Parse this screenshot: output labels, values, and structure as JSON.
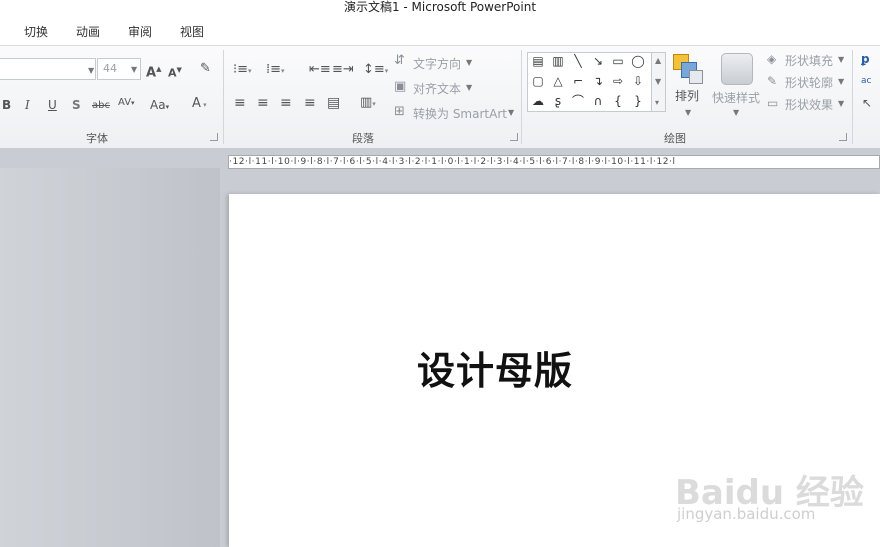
{
  "window": {
    "title": "演示文稿1 - Microsoft PowerPoint"
  },
  "tabs": [
    {
      "label": "切换"
    },
    {
      "label": "动画"
    },
    {
      "label": "审阅"
    },
    {
      "label": "视图"
    }
  ],
  "font_group": {
    "label": "字体",
    "font_size": "44"
  },
  "paragraph_group": {
    "label": "段落",
    "text_direction": "文字方向",
    "align_text": "对齐文本",
    "convert_smartart": "转换为 SmartArt"
  },
  "drawing_group": {
    "label": "绘图",
    "arrange": "排列",
    "quick_styles": "快速样式",
    "shape_fill": "形状填充",
    "shape_outline": "形状轮廓",
    "shape_effects": "形状效果"
  },
  "ruler": {
    "text": "·12·l·11·l·10·l·9·l·8·l·7·l·6·l·5·l·4·l·3·l·2·l·1·l·0·l·1·l·2·l·3·l·4·l·5·l·6·l·7·l·8·l·9·l·10·l·11·l·12·l"
  },
  "slide": {
    "text": "设计母版"
  },
  "watermark": {
    "brand": "Baidu 经验",
    "url": "jingyan.baidu.com"
  }
}
